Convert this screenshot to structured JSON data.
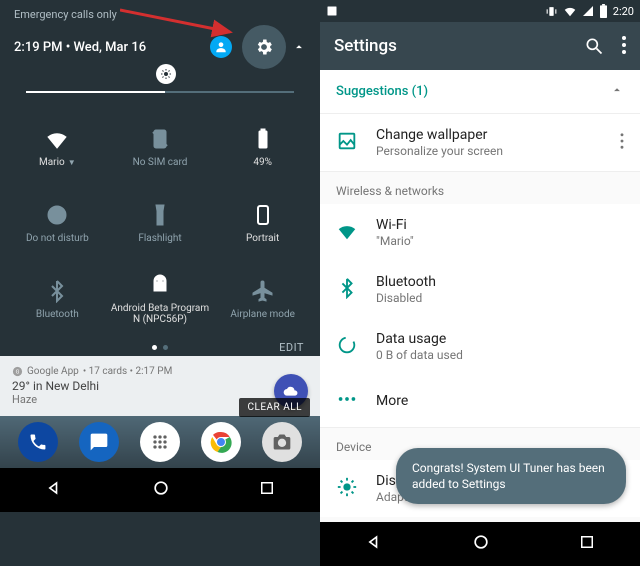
{
  "left": {
    "emergency": "Emergency calls only",
    "datetime": "2:19 PM  •  Wed, Mar 16",
    "tiles": [
      {
        "icon": "wifi",
        "label": "Mario",
        "active": true,
        "chev": true
      },
      {
        "icon": "sim",
        "label": "No SIM card",
        "active": false
      },
      {
        "icon": "battery",
        "label": "49%",
        "active": true
      },
      {
        "icon": "dnd",
        "label": "Do not disturb",
        "active": false
      },
      {
        "icon": "flashlight",
        "label": "Flashlight",
        "active": false
      },
      {
        "icon": "portrait",
        "label": "Portrait",
        "active": true
      },
      {
        "icon": "bluetooth",
        "label": "Bluetooth",
        "active": false
      },
      {
        "icon": "android",
        "label": "Android Beta Program N (NPC56P)",
        "active": true
      },
      {
        "icon": "airplane",
        "label": "Airplane mode",
        "active": false
      }
    ],
    "edit": "EDIT",
    "notif": {
      "app": "Google App",
      "meta": " • 17 cards • 2:17 PM",
      "line1": "29° in New Delhi",
      "line2": "Haze"
    },
    "clear_all": "CLEAR ALL"
  },
  "right": {
    "status_time": "2:20",
    "title": "Settings",
    "suggestions_label": "Suggestions (1)",
    "suggestion": {
      "title": "Change wallpaper",
      "sub": "Personalize your screen"
    },
    "cat1": "Wireless & networks",
    "items": [
      {
        "icon": "wifi",
        "title": "Wi-Fi",
        "sub": "\"Mario\""
      },
      {
        "icon": "bluetooth",
        "title": "Bluetooth",
        "sub": "Disabled"
      },
      {
        "icon": "data",
        "title": "Data usage",
        "sub": "0 B of data used"
      },
      {
        "icon": "more",
        "title": "More",
        "sub": ""
      }
    ],
    "cat2": "Device",
    "display": {
      "title": "Display",
      "sub": "Adaptive brightness is ON"
    },
    "toast": "Congrats! System UI Tuner has been added to Settings"
  }
}
